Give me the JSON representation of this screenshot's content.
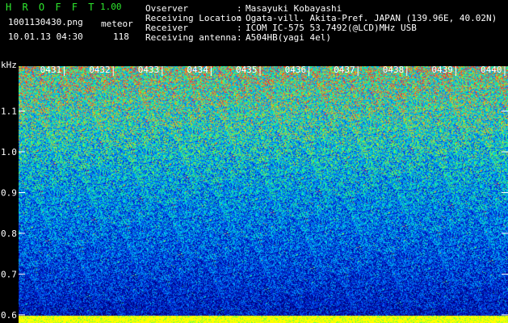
{
  "header": {
    "app_title": "H R O F F T",
    "app_version": "1.00",
    "filename": "1001130430.png",
    "datetime": "10.01.13 04:30",
    "meteor_label": "meteor",
    "meteor_count": "118",
    "info": [
      {
        "label": "Ovserver",
        "value": "Masayuki Kobayashi"
      },
      {
        "label": "Receiving Location",
        "value": "Ogata-vill. Akita-Pref. JAPAN (139.96E, 40.02N)"
      },
      {
        "label": "Receiver",
        "value": "ICOM IC-575 53.7492(@LCD)MHz USB"
      },
      {
        "label": "Receiving antenna",
        "value": "A504HB(yagi 4el)"
      }
    ],
    "separator": ":"
  },
  "chart_data": {
    "type": "heatmap",
    "ylabel": "kHz",
    "y_ticks": [
      1.1,
      1.0,
      0.9,
      0.8,
      0.7,
      0.6
    ],
    "y_tick_labels": [
      "1.1",
      "1.0",
      "0.9",
      "0.8",
      "0.7",
      "0.6"
    ],
    "ylim": [
      0.58,
      1.21
    ],
    "x_ticks": [
      "0431",
      "0432",
      "0433",
      "0434",
      "0435",
      "0436",
      "0437",
      "0438",
      "0439",
      "0440"
    ],
    "xlim": [
      "0430",
      "0440"
    ],
    "colors": {
      "low": "#000080",
      "mid": "#00a0ff",
      "high": "#00ff80",
      "peak": "#ff3020",
      "baseline": "#ffff00"
    }
  }
}
